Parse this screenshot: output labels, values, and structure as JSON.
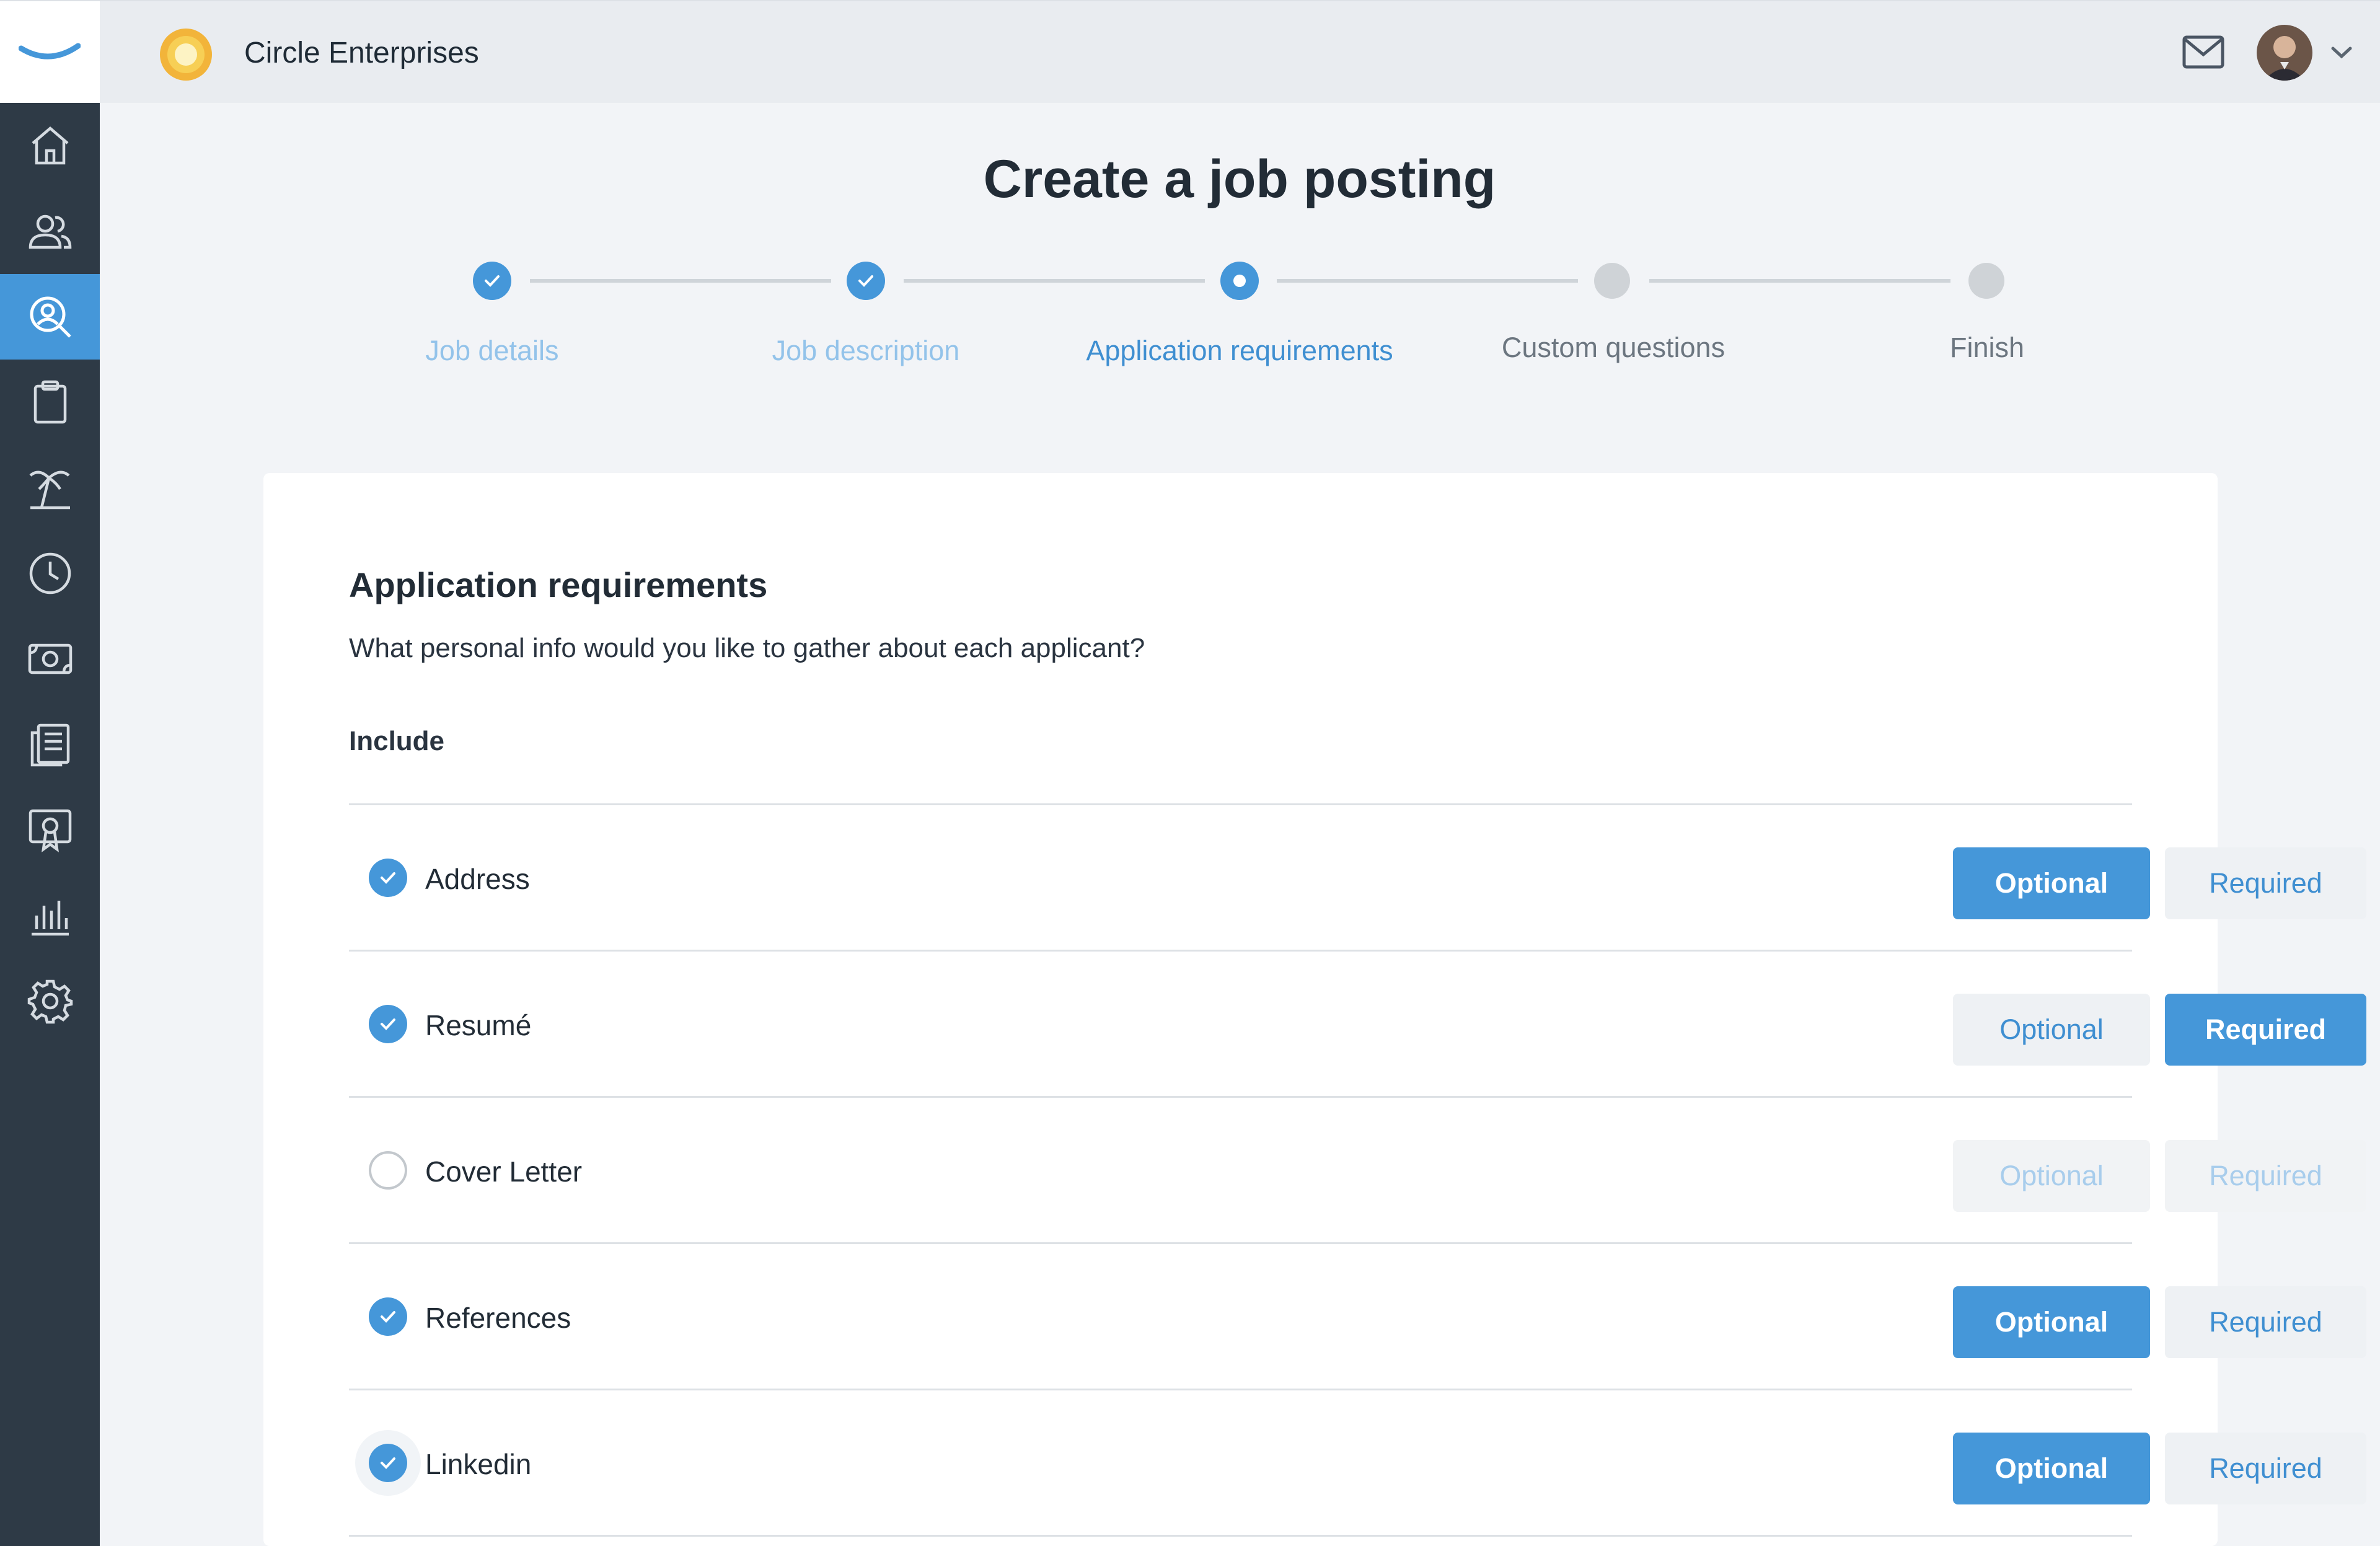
{
  "header": {
    "company_name": "Circle Enterprises",
    "brand_color": "#4597d9",
    "icons": [
      "brand-logo-icon",
      "company-logo-icon",
      "mail-icon",
      "avatar",
      "chevron-down-icon"
    ]
  },
  "sidebar": {
    "items": [
      {
        "name": "home",
        "icon": "home-icon",
        "active": false
      },
      {
        "name": "people",
        "icon": "users-icon",
        "active": false
      },
      {
        "name": "recruiting",
        "icon": "person-search-icon",
        "active": true
      },
      {
        "name": "tasks",
        "icon": "clipboard-icon",
        "active": false
      },
      {
        "name": "time-off",
        "icon": "palm-tree-icon",
        "active": false
      },
      {
        "name": "time",
        "icon": "clock-icon",
        "active": false
      },
      {
        "name": "payroll",
        "icon": "money-icon",
        "active": false
      },
      {
        "name": "documents",
        "icon": "documents-icon",
        "active": false
      },
      {
        "name": "training",
        "icon": "certificate-icon",
        "active": false
      },
      {
        "name": "reports",
        "icon": "bar-chart-icon",
        "active": false
      },
      {
        "name": "settings",
        "icon": "gear-icon",
        "active": false
      }
    ]
  },
  "page": {
    "title": "Create a job posting"
  },
  "stepper": {
    "steps": [
      {
        "label": "Job details",
        "state": "done"
      },
      {
        "label": "Job description",
        "state": "done"
      },
      {
        "label": "Application requirements",
        "state": "current"
      },
      {
        "label": "Custom questions",
        "state": "todo"
      },
      {
        "label": "Finish",
        "state": "todo"
      }
    ]
  },
  "card": {
    "heading": "Application requirements",
    "subtitle": "What personal info would you like to gather about each applicant?",
    "include_label": "Include",
    "optional_label": "Optional",
    "required_label": "Required",
    "rows": [
      {
        "label": "Address",
        "included": true,
        "selection": "Optional"
      },
      {
        "label": "Resumé",
        "included": true,
        "selection": "Required"
      },
      {
        "label": "Cover Letter",
        "included": false,
        "selection": null
      },
      {
        "label": "References",
        "included": true,
        "selection": "Optional"
      },
      {
        "label": "Linkedin",
        "included": true,
        "selection": "Optional"
      }
    ]
  }
}
